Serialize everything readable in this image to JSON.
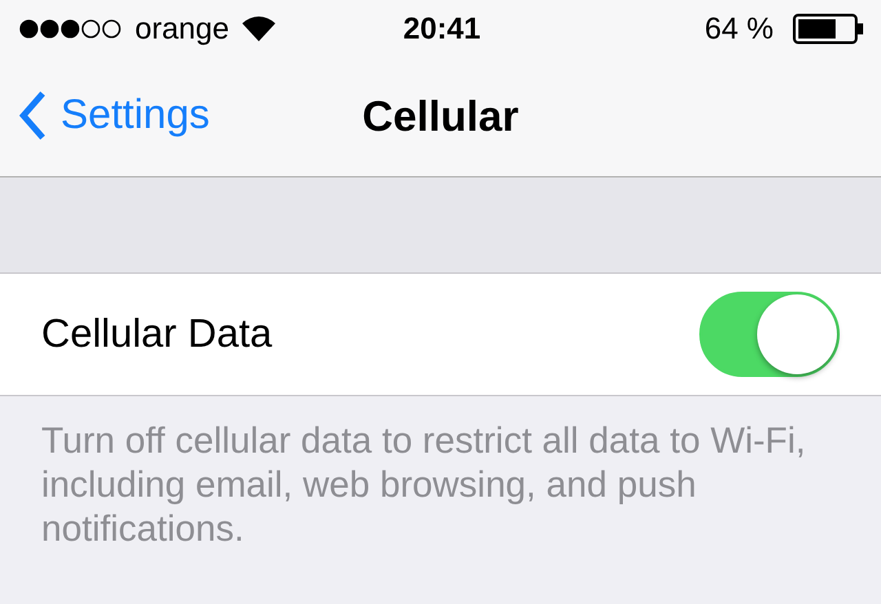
{
  "status_bar": {
    "carrier": "orange",
    "time": "20:41",
    "battery": "64 %"
  },
  "nav": {
    "back": "Settings",
    "title": "Cellular"
  },
  "rows": [
    {
      "kind": "toggle",
      "label": "Cellular Data",
      "on": true
    }
  ],
  "footer": "Turn off cellular data to restrict all data to Wi-Fi, including email, web browsing, and push notifications."
}
